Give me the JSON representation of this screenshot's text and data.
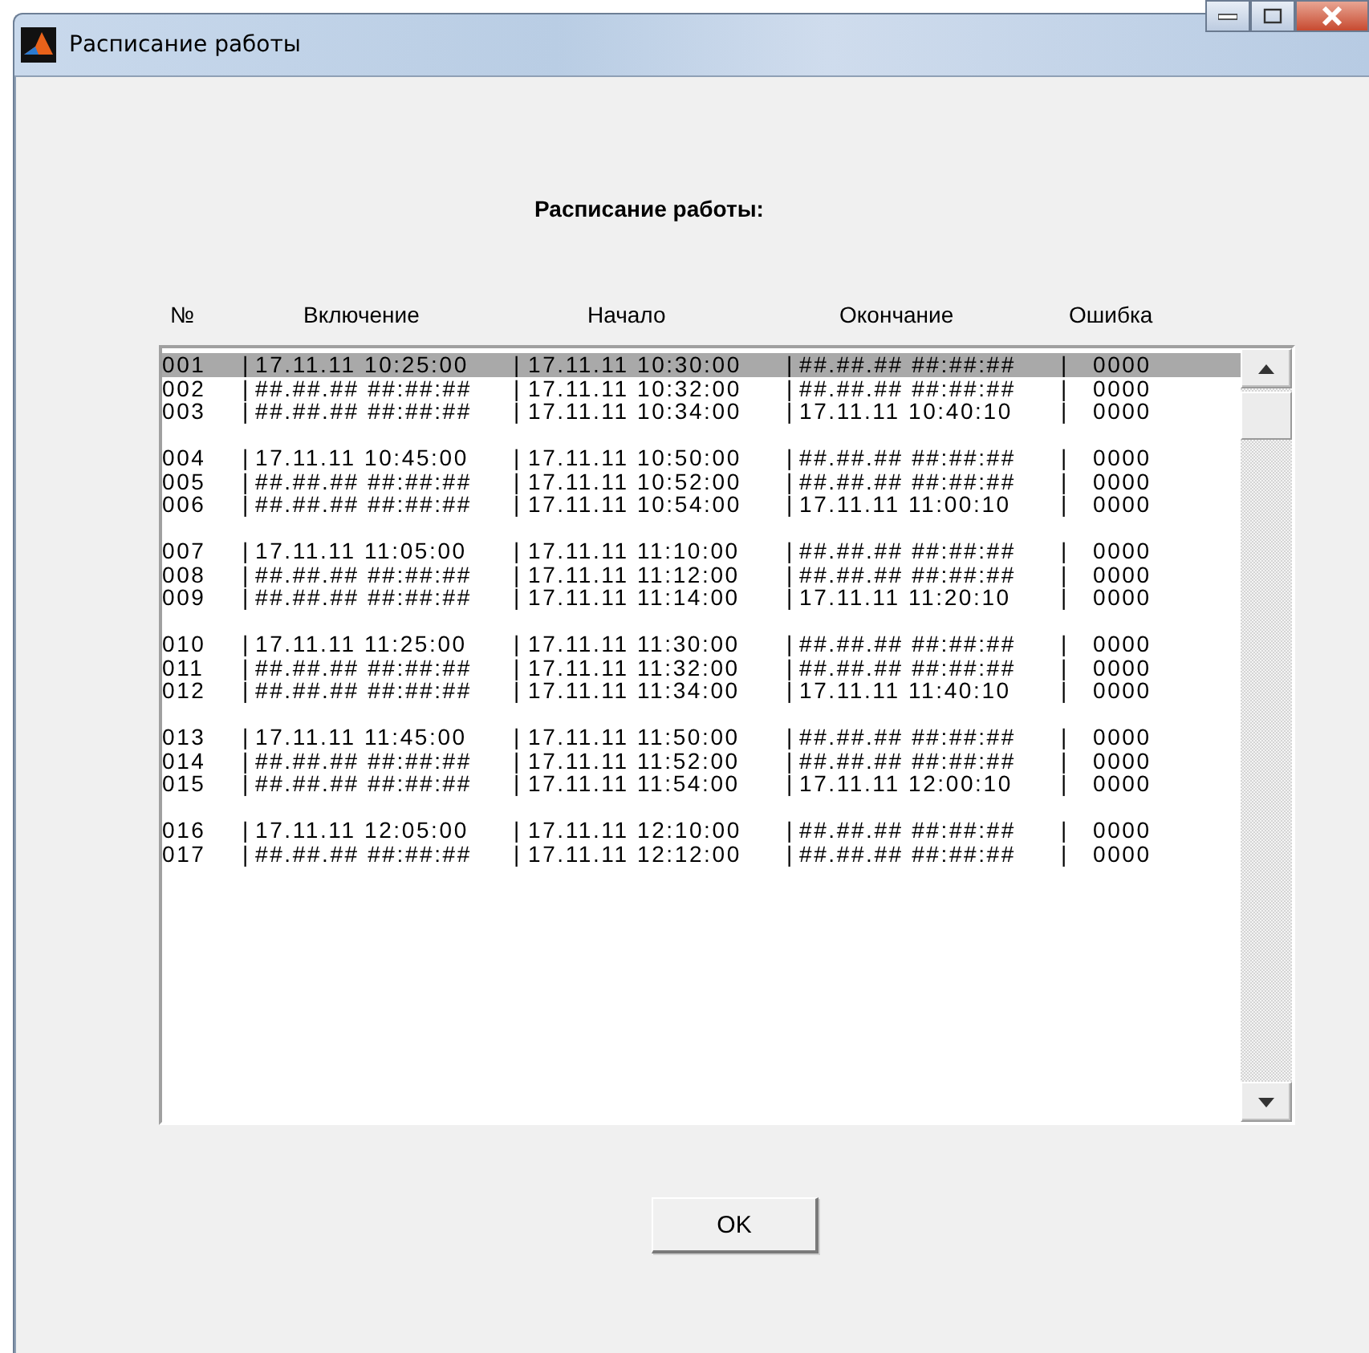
{
  "window": {
    "title": "Расписание работы"
  },
  "heading": "Расписание работы:",
  "columns": [
    "№",
    "Включение",
    "Начало",
    "Окончание",
    "Ошибка"
  ],
  "list": {
    "groups": [
      [
        {
          "selected": true,
          "cells": [
            "001",
            "|",
            "17.11.11 10:25:00",
            "|",
            "17.11.11 10:30:00",
            "|",
            "##.##.## ##:##:##",
            "|",
            "0000"
          ]
        },
        {
          "selected": false,
          "cells": [
            "002",
            "|",
            "##.##.## ##:##:##",
            "|",
            "17.11.11 10:32:00",
            "|",
            "##.##.## ##:##:##",
            "|",
            "0000"
          ]
        },
        {
          "selected": false,
          "cells": [
            "003",
            "|",
            "##.##.## ##:##:##",
            "|",
            "17.11.11 10:34:00",
            "|",
            "17.11.11 10:40:10",
            "|",
            "0000"
          ]
        }
      ],
      [
        {
          "selected": false,
          "cells": [
            "004",
            "|",
            "17.11.11 10:45:00",
            "|",
            "17.11.11 10:50:00",
            "|",
            "##.##.## ##:##:##",
            "|",
            "0000"
          ]
        },
        {
          "selected": false,
          "cells": [
            "005",
            "|",
            "##.##.## ##:##:##",
            "|",
            "17.11.11 10:52:00",
            "|",
            "##.##.## ##:##:##",
            "|",
            "0000"
          ]
        },
        {
          "selected": false,
          "cells": [
            "006",
            "|",
            "##.##.## ##:##:##",
            "|",
            "17.11.11 10:54:00",
            "|",
            "17.11.11 11:00:10",
            "|",
            "0000"
          ]
        }
      ],
      [
        {
          "selected": false,
          "cells": [
            "007",
            "|",
            "17.11.11 11:05:00",
            "|",
            "17.11.11 11:10:00",
            "|",
            "##.##.## ##:##:##",
            "|",
            "0000"
          ]
        },
        {
          "selected": false,
          "cells": [
            "008",
            "|",
            "##.##.## ##:##:##",
            "|",
            "17.11.11 11:12:00",
            "|",
            "##.##.## ##:##:##",
            "|",
            "0000"
          ]
        },
        {
          "selected": false,
          "cells": [
            "009",
            "|",
            "##.##.## ##:##:##",
            "|",
            "17.11.11 11:14:00",
            "|",
            "17.11.11 11:20:10",
            "|",
            "0000"
          ]
        }
      ],
      [
        {
          "selected": false,
          "cells": [
            "010",
            "|",
            "17.11.11 11:25:00",
            "|",
            "17.11.11 11:30:00",
            "|",
            "##.##.## ##:##:##",
            "|",
            "0000"
          ]
        },
        {
          "selected": false,
          "cells": [
            "011",
            "|",
            "##.##.## ##:##:##",
            "|",
            "17.11.11 11:32:00",
            "|",
            "##.##.## ##:##:##",
            "|",
            "0000"
          ]
        },
        {
          "selected": false,
          "cells": [
            "012",
            "|",
            "##.##.## ##:##:##",
            "|",
            "17.11.11 11:34:00",
            "|",
            "17.11.11 11:40:10",
            "|",
            "0000"
          ]
        }
      ],
      [
        {
          "selected": false,
          "cells": [
            "013",
            "|",
            "17.11.11 11:45:00",
            "|",
            "17.11.11 11:50:00",
            "|",
            "##.##.## ##:##:##",
            "|",
            "0000"
          ]
        },
        {
          "selected": false,
          "cells": [
            "014",
            "|",
            "##.##.## ##:##:##",
            "|",
            "17.11.11 11:52:00",
            "|",
            "##.##.## ##:##:##",
            "|",
            "0000"
          ]
        },
        {
          "selected": false,
          "cells": [
            "015",
            "|",
            "##.##.## ##:##:##",
            "|",
            "17.11.11 11:54:00",
            "|",
            "17.11.11 12:00:10",
            "|",
            "0000"
          ]
        }
      ],
      [
        {
          "selected": false,
          "cells": [
            "016",
            "|",
            "17.11.11 12:05:00",
            "|",
            "17.11.11 12:10:00",
            "|",
            "##.##.## ##:##:##",
            "|",
            "0000"
          ]
        },
        {
          "selected": false,
          "cells": [
            "017",
            "|",
            "##.##.## ##:##:##",
            "|",
            "17.11.11 12:12:00",
            "|",
            "##.##.## ##:##:##",
            "|",
            "0000"
          ]
        }
      ]
    ]
  },
  "buttons": [
    "OK"
  ]
}
